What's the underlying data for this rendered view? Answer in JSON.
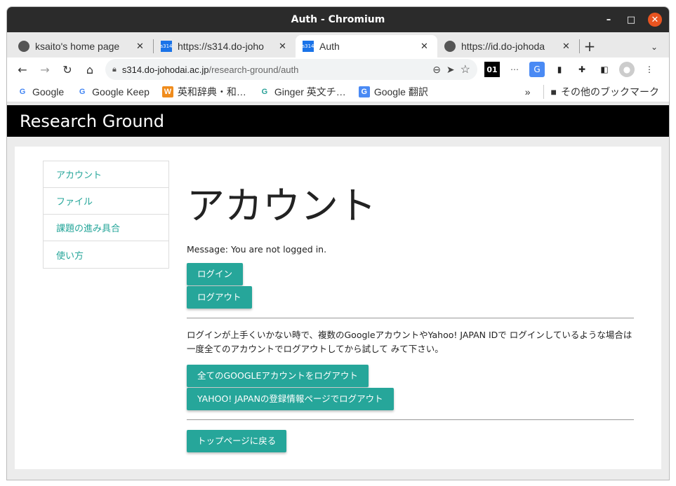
{
  "window": {
    "title": "Auth - Chromium"
  },
  "tabs": [
    {
      "title": "ksaito's home page",
      "favicon": "globe-icon",
      "active": false
    },
    {
      "title": "https://s314.do-joho",
      "favicon": "s314-icon",
      "active": false
    },
    {
      "title": "Auth",
      "favicon": "s314-icon",
      "active": true
    },
    {
      "title": "https://id.do-johoda",
      "favicon": "globe-icon",
      "active": false
    }
  ],
  "omnibox": {
    "host": "s314.do-johodai.ac.jp",
    "path": "/research-ground/auth"
  },
  "extensions": {
    "ext1": "01",
    "ext2": "⋯",
    "ext3": "G"
  },
  "bookmarks": [
    {
      "label": "Google",
      "icon": "G"
    },
    {
      "label": "Google Keep",
      "icon": "G"
    },
    {
      "label": "英和辞典・和…",
      "icon": "W"
    },
    {
      "label": "Ginger 英文チ…",
      "icon": "G"
    },
    {
      "label": "Google 翻訳",
      "icon": "G"
    }
  ],
  "bookmarks_overflow": "»",
  "other_bookmarks": "その他のブックマーク",
  "site": {
    "title": "Research Ground"
  },
  "sidenav": [
    "アカウント",
    "ファイル",
    "課題の進み具合",
    "使い方"
  ],
  "main": {
    "heading": "アカウント",
    "message": "Message: You are not logged in.",
    "login_button": "ログイン",
    "logout_button": "ログアウト",
    "note": "ログインが上手くいかない時で、複数のGoogleアカウントやYahoo! JAPAN IDで ログインしているような場合は一度全てのアカウントでログアウトしてから試して みて下さい。",
    "google_logout_button": "全てのGOOGLEアカウントをログアウト",
    "yahoo_logout_button": "YAHOO! JAPANの登録情報ページでログアウト",
    "top_button": "トップページに戻る"
  },
  "colors": {
    "accent": "#26a69a",
    "header_bg": "#000000",
    "close_button": "#e95420"
  }
}
